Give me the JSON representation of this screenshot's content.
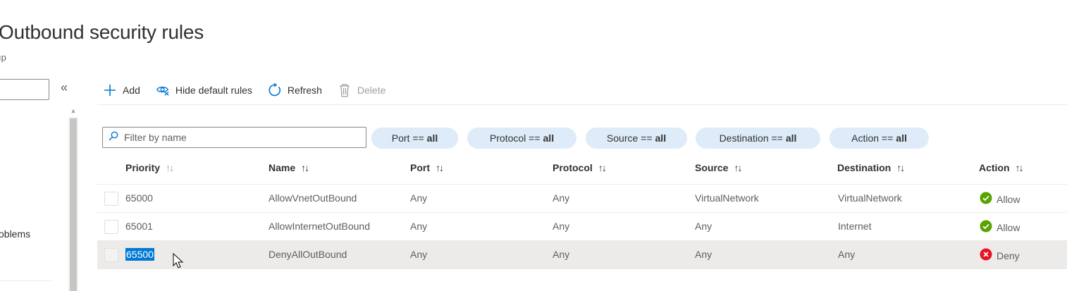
{
  "page": {
    "title": "Outbound security rules",
    "subtitle": "ıp"
  },
  "left_nav": {
    "collapse_glyph": "«",
    "search_value": "",
    "problems_label": "oblems"
  },
  "toolbar": {
    "add_label": "Add",
    "hide_default_label": "Hide default rules",
    "refresh_label": "Refresh",
    "delete_label": "Delete"
  },
  "filter": {
    "placeholder": "Filter by name",
    "value": ""
  },
  "pills": [
    {
      "key": "Port ==",
      "value": "all"
    },
    {
      "key": "Protocol ==",
      "value": "all"
    },
    {
      "key": "Source ==",
      "value": "all"
    },
    {
      "key": "Destination ==",
      "value": "all"
    },
    {
      "key": "Action ==",
      "value": "all"
    }
  ],
  "columns": [
    "Priority",
    "Name",
    "Port",
    "Protocol",
    "Source",
    "Destination",
    "Action"
  ],
  "sort_glyph": "↑↓",
  "rows": [
    {
      "priority": "65000",
      "name": "AllowVnetOutBound",
      "port": "Any",
      "protocol": "Any",
      "source": "VirtualNetwork",
      "destination": "VirtualNetwork",
      "action": "Allow"
    },
    {
      "priority": "65001",
      "name": "AllowInternetOutBound",
      "port": "Any",
      "protocol": "Any",
      "source": "Any",
      "destination": "Internet",
      "action": "Allow"
    },
    {
      "priority": "65500",
      "name": "DenyAllOutBound",
      "port": "Any",
      "protocol": "Any",
      "source": "Any",
      "destination": "Any",
      "action": "Deny"
    }
  ],
  "icons": {
    "add": "plus-icon",
    "hide_default": "eye-hide-icon",
    "refresh": "refresh-icon",
    "delete": "trash-icon",
    "filter": "search-icon",
    "allow": "check-circle-icon",
    "deny": "error-circle-icon"
  },
  "colors": {
    "accent": "#0078d4",
    "pill_bg": "#deecf9",
    "allow": "#57a300",
    "deny": "#e81123",
    "selected_row": "#edebe9"
  }
}
